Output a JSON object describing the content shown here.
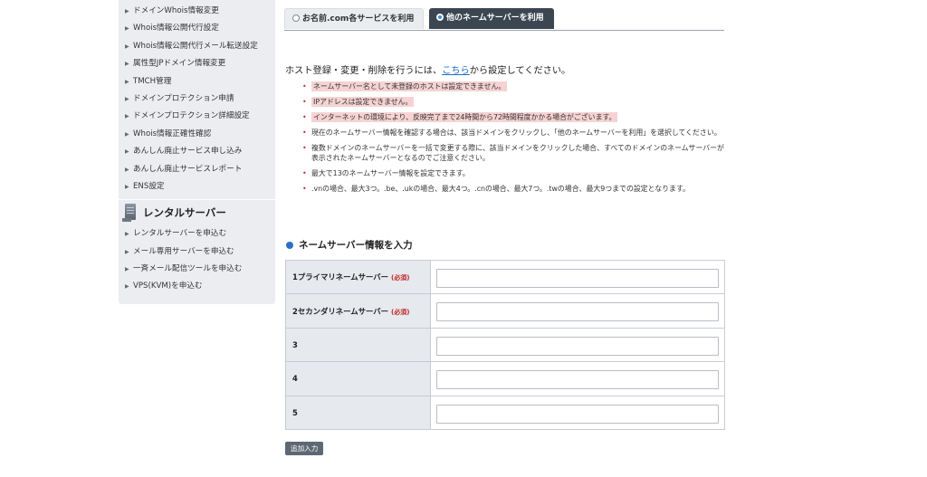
{
  "sidebar": {
    "domain_items": [
      {
        "label": "ドメインWhois情報変更"
      },
      {
        "label": "Whois情報公開代行設定"
      },
      {
        "label": "Whois情報公開代行メール転送設定"
      },
      {
        "label": "属性型JPドメイン情報変更"
      },
      {
        "label": "TMCH管理"
      },
      {
        "label": "ドメインプロテクション申請"
      },
      {
        "label": "ドメインプロテクション詳細設定"
      },
      {
        "label": "Whois情報正確性確認"
      },
      {
        "label": "あんしん廃止サービス申し込み"
      },
      {
        "label": "あんしん廃止サービスレポート"
      },
      {
        "label": "ENS設定"
      }
    ],
    "section_title": "レンタルサーバー",
    "server_items": [
      {
        "label": "レンタルサーバーを申込む"
      },
      {
        "label": "メール専用サーバーを申込む"
      },
      {
        "label": "一斉メール配信ツールを申込む"
      },
      {
        "label": "VPS(KVM)を申込む"
      }
    ],
    "arrow_glyph": "▶"
  },
  "tabs": {
    "inactive_label": "お名前.com各サービスを利用",
    "active_label": "他のネームサーバーを利用"
  },
  "intro": {
    "prefix": "ホスト登録・変更・削除を行うには、",
    "link": "こちら",
    "suffix": "から設定してください。"
  },
  "notes": [
    {
      "text": "ネームサーバー名として未登録のホストは設定できません。",
      "highlight": true
    },
    {
      "text": "IPアドレスは設定できません。",
      "highlight": true
    },
    {
      "text": "インターネットの環境により、反映完了まで24時間から72時間程度かかる場合がございます。",
      "highlight": true
    },
    {
      "text": "現在のネームサーバー情報を確認する場合は、該当ドメインをクリックし、「他のネームサーバーを利用」を選択してください。",
      "highlight": false
    },
    {
      "text": "複数ドメインのネームサーバーを一括で変更する際に、該当ドメインをクリックした場合、すべてのドメインのネームサーバーが表示されたネームサーバーとなるのでご注意ください。",
      "highlight": false
    },
    {
      "text": "最大で13のネームサーバー情報を設定できます。",
      "highlight": false
    },
    {
      "text": ".vnの場合、最大3つ。.be、.ukの場合、最大4つ。.cnの場合、最大7つ。.twの場合、最大9つまでの設定となります。",
      "highlight": false
    }
  ],
  "note_bullet": "•",
  "form": {
    "section_title": "ネームサーバー情報を入力",
    "rows": [
      {
        "label": "1プライマリネームサーバー",
        "required": "(必須)",
        "value": ""
      },
      {
        "label": "2セカンダリネームサーバー",
        "required": "(必須)",
        "value": ""
      },
      {
        "label": "3",
        "required": "",
        "value": ""
      },
      {
        "label": "4",
        "required": "",
        "value": ""
      },
      {
        "label": "5",
        "required": "",
        "value": ""
      }
    ],
    "add_button": "追加入力"
  },
  "colors": {
    "sidebar_bg": "#ebedf1",
    "active_tab": "#3b4651",
    "highlight": "#f6d3d3",
    "bullet_red": "#d02a2a",
    "accent_blue": "#2a6fc9"
  }
}
